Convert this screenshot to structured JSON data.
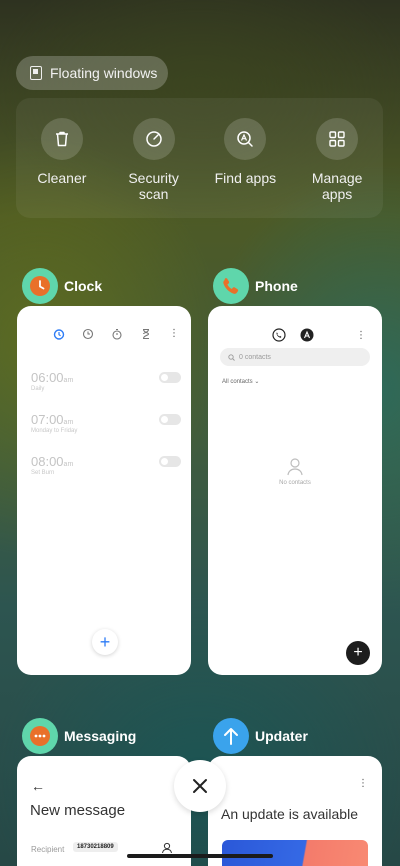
{
  "floating_windows": {
    "label": "Floating windows"
  },
  "quick_actions": [
    {
      "label": "Cleaner",
      "icon": "trash-icon"
    },
    {
      "label": "Security\nscan",
      "icon": "security-scan-icon"
    },
    {
      "label": "Find apps",
      "icon": "find-apps-icon"
    },
    {
      "label": "Manage\napps",
      "icon": "grid-icon"
    }
  ],
  "apps": {
    "clock": {
      "name": "Clock",
      "icon_color": "#5fd6ab",
      "accent": "#e9702a",
      "alarms": [
        {
          "time": "06:00",
          "ampm": "am",
          "repeat": "Daily"
        },
        {
          "time": "07:00",
          "ampm": "am",
          "repeat": "Monday to Friday"
        },
        {
          "time": "08:00",
          "ampm": "am",
          "repeat": "Set Burn"
        }
      ],
      "fab": "+"
    },
    "phone": {
      "name": "Phone",
      "icon_color": "#5fd6ab",
      "accent": "#e9702a",
      "search_placeholder": "0 contacts",
      "all_contacts": "All contacts",
      "empty_label": "No contacts",
      "fab": "+"
    },
    "messaging": {
      "name": "Messaging",
      "icon_color": "#5fd6ab",
      "accent": "#e9702a",
      "back": "←",
      "title": "New message",
      "recipient_label": "Recipient",
      "recipient_value": "18730218809"
    },
    "updater": {
      "name": "Updater",
      "icon_color": "#3aa3ec",
      "title": "An update is available"
    }
  },
  "close": {
    "icon": "close-icon"
  }
}
